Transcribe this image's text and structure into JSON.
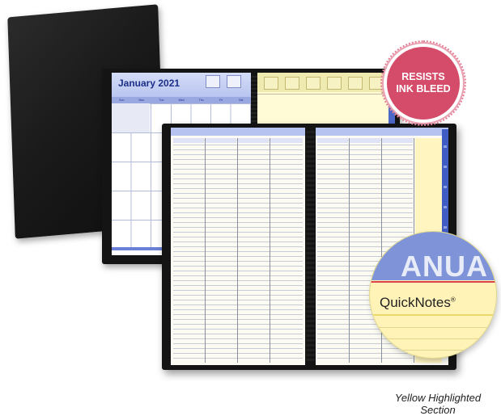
{
  "monthly_planner": {
    "month_title": "January 2021",
    "weekday_headers": [
      "Sun",
      "Mon",
      "Tue",
      "Wed",
      "Thu",
      "Fri",
      "Sat"
    ]
  },
  "badge": {
    "line1": "RESISTS",
    "line2": "INK BLEED"
  },
  "magnifier": {
    "background_text": "ANUA",
    "label": "QuickNotes",
    "registered_mark": "®"
  },
  "caption": {
    "line1": "Yellow Highlighted",
    "line2": "Section"
  },
  "colors": {
    "badge": "#d54c6a",
    "planner_blue": "#3f5cc4",
    "highlight_yellow": "#fff5c0",
    "cover_black": "#141414"
  }
}
